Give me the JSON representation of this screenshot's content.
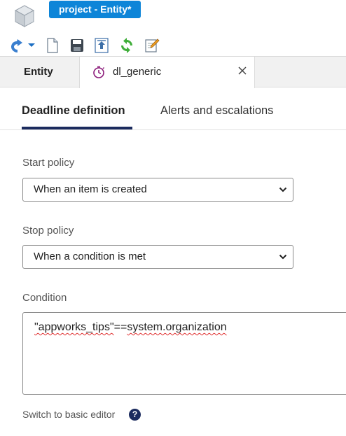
{
  "window": {
    "title": "project - Entity*"
  },
  "toolbar": {
    "icons": [
      "back-icon",
      "new-document-icon",
      "save-icon",
      "publish-icon",
      "refresh-icon",
      "edit-icon"
    ]
  },
  "doc_tabs": {
    "entity_label": "Entity",
    "active_label": "dl_generic"
  },
  "sub_tabs": {
    "deadline_label": "Deadline definition",
    "alerts_label": "Alerts and escalations"
  },
  "form": {
    "start_policy_label": "Start policy",
    "start_policy_value": "When an item is created",
    "stop_policy_label": "Stop policy",
    "stop_policy_value": "When a condition is met",
    "condition_label": "Condition",
    "condition_part1": "\"appworks_tips\"",
    "condition_part2": "==",
    "condition_part3": "system.organization",
    "switch_editor_label": "Switch to basic editor",
    "help_glyph": "?"
  },
  "colors": {
    "title_tab": "#0d85d8",
    "active_underline": "#1b2b5e",
    "tab_icon": "#8b1a7a"
  }
}
